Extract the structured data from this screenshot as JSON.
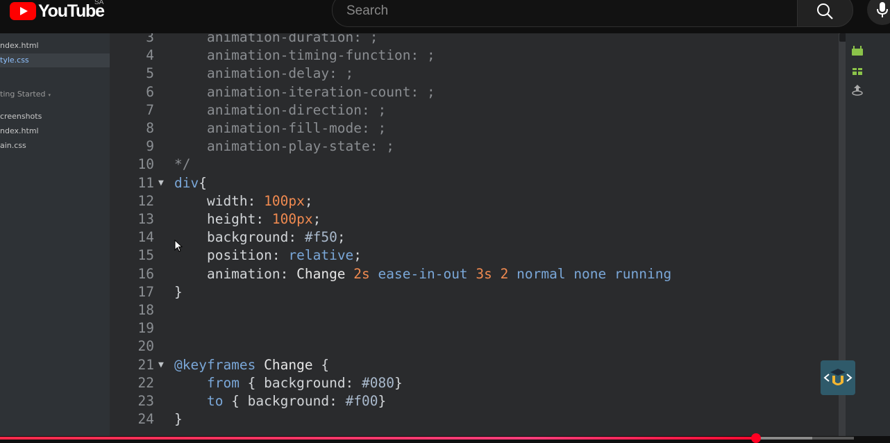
{
  "youtube": {
    "logo_text": "YouTube",
    "region": "SA",
    "search_placeholder": "Search",
    "progress": {
      "played_fraction": 0.885,
      "loaded_fraction": 0.951
    }
  },
  "file_tree": {
    "items": [
      {
        "label": "ndex.html",
        "state": "normal"
      },
      {
        "label": "tyle.css",
        "state": "active"
      },
      {
        "label": "ting Started",
        "state": "section"
      },
      {
        "label": "creenshots",
        "state": "normal"
      },
      {
        "label": "ndex.html",
        "state": "normal"
      },
      {
        "label": "ain.css",
        "state": "normal"
      }
    ]
  },
  "code": {
    "lines": [
      {
        "n": "3",
        "segments": [
          [
            "    animation-duration: ;",
            "dim"
          ]
        ]
      },
      {
        "n": "4",
        "segments": [
          [
            "    animation-timing-function: ;",
            "dim"
          ]
        ]
      },
      {
        "n": "5",
        "segments": [
          [
            "    animation-delay: ;",
            "dim"
          ]
        ]
      },
      {
        "n": "6",
        "segments": [
          [
            "    animation-iteration-count: ;",
            "dim"
          ]
        ]
      },
      {
        "n": "7",
        "segments": [
          [
            "    animation-direction: ;",
            "dim"
          ]
        ]
      },
      {
        "n": "8",
        "segments": [
          [
            "    animation-fill-mode: ;",
            "dim"
          ]
        ]
      },
      {
        "n": "9",
        "segments": [
          [
            "    animation-play-state: ;",
            "dim"
          ]
        ]
      },
      {
        "n": "10",
        "segments": [
          [
            "*/",
            "dim"
          ]
        ]
      },
      {
        "n": "11",
        "fold": true,
        "segments": [
          [
            "div",
            "kw"
          ],
          [
            "{",
            "plain"
          ]
        ]
      },
      {
        "n": "12",
        "segments": [
          [
            "    width: ",
            "plain"
          ],
          [
            "100px",
            "num"
          ],
          [
            ";",
            "plain"
          ]
        ]
      },
      {
        "n": "13",
        "segments": [
          [
            "    height: ",
            "plain"
          ],
          [
            "100px",
            "num"
          ],
          [
            ";",
            "plain"
          ]
        ]
      },
      {
        "n": "14",
        "segments": [
          [
            "    background: ",
            "plain"
          ],
          [
            "#f50",
            "hex"
          ],
          [
            ";",
            "plain"
          ]
        ]
      },
      {
        "n": "15",
        "segments": [
          [
            "    position: ",
            "plain"
          ],
          [
            "relative",
            "val"
          ],
          [
            ";",
            "plain"
          ]
        ]
      },
      {
        "n": "16",
        "segments": [
          [
            "    animation: ",
            "plain"
          ],
          [
            "Change ",
            "name"
          ],
          [
            "2s ",
            "num"
          ],
          [
            "ease-in-out ",
            "val"
          ],
          [
            "3s ",
            "num"
          ],
          [
            "2 ",
            "num"
          ],
          [
            "normal none running",
            "val"
          ]
        ]
      },
      {
        "n": "17",
        "segments": [
          [
            "}",
            "plain"
          ]
        ]
      },
      {
        "n": "18",
        "segments": []
      },
      {
        "n": "19",
        "segments": []
      },
      {
        "n": "20",
        "segments": []
      },
      {
        "n": "21",
        "fold": true,
        "segments": [
          [
            "@keyframes ",
            "kw"
          ],
          [
            "Change ",
            "name"
          ],
          [
            "{",
            "plain"
          ]
        ]
      },
      {
        "n": "22",
        "segments": [
          [
            "    ",
            "plain"
          ],
          [
            "from",
            "val"
          ],
          [
            " { background: ",
            "plain"
          ],
          [
            "#080",
            "hex"
          ],
          [
            "}",
            "plain"
          ]
        ]
      },
      {
        "n": "23",
        "segments": [
          [
            "    ",
            "plain"
          ],
          [
            "to",
            "val"
          ],
          [
            " { background: ",
            "plain"
          ],
          [
            "#f00",
            "hex"
          ],
          [
            "}",
            "plain"
          ]
        ]
      },
      {
        "n": "24",
        "segments": [
          [
            "}",
            "plain"
          ]
        ]
      }
    ]
  },
  "colors": {
    "editor_bg": "#2a2b2d",
    "keyword": "#7aa7d8",
    "number": "#f08a50",
    "accent_red": "#ff0000"
  },
  "icons": [
    "search-icon",
    "mic-icon",
    "android-icon",
    "gift-icon",
    "upload-icon",
    "logo-badge-icon"
  ]
}
